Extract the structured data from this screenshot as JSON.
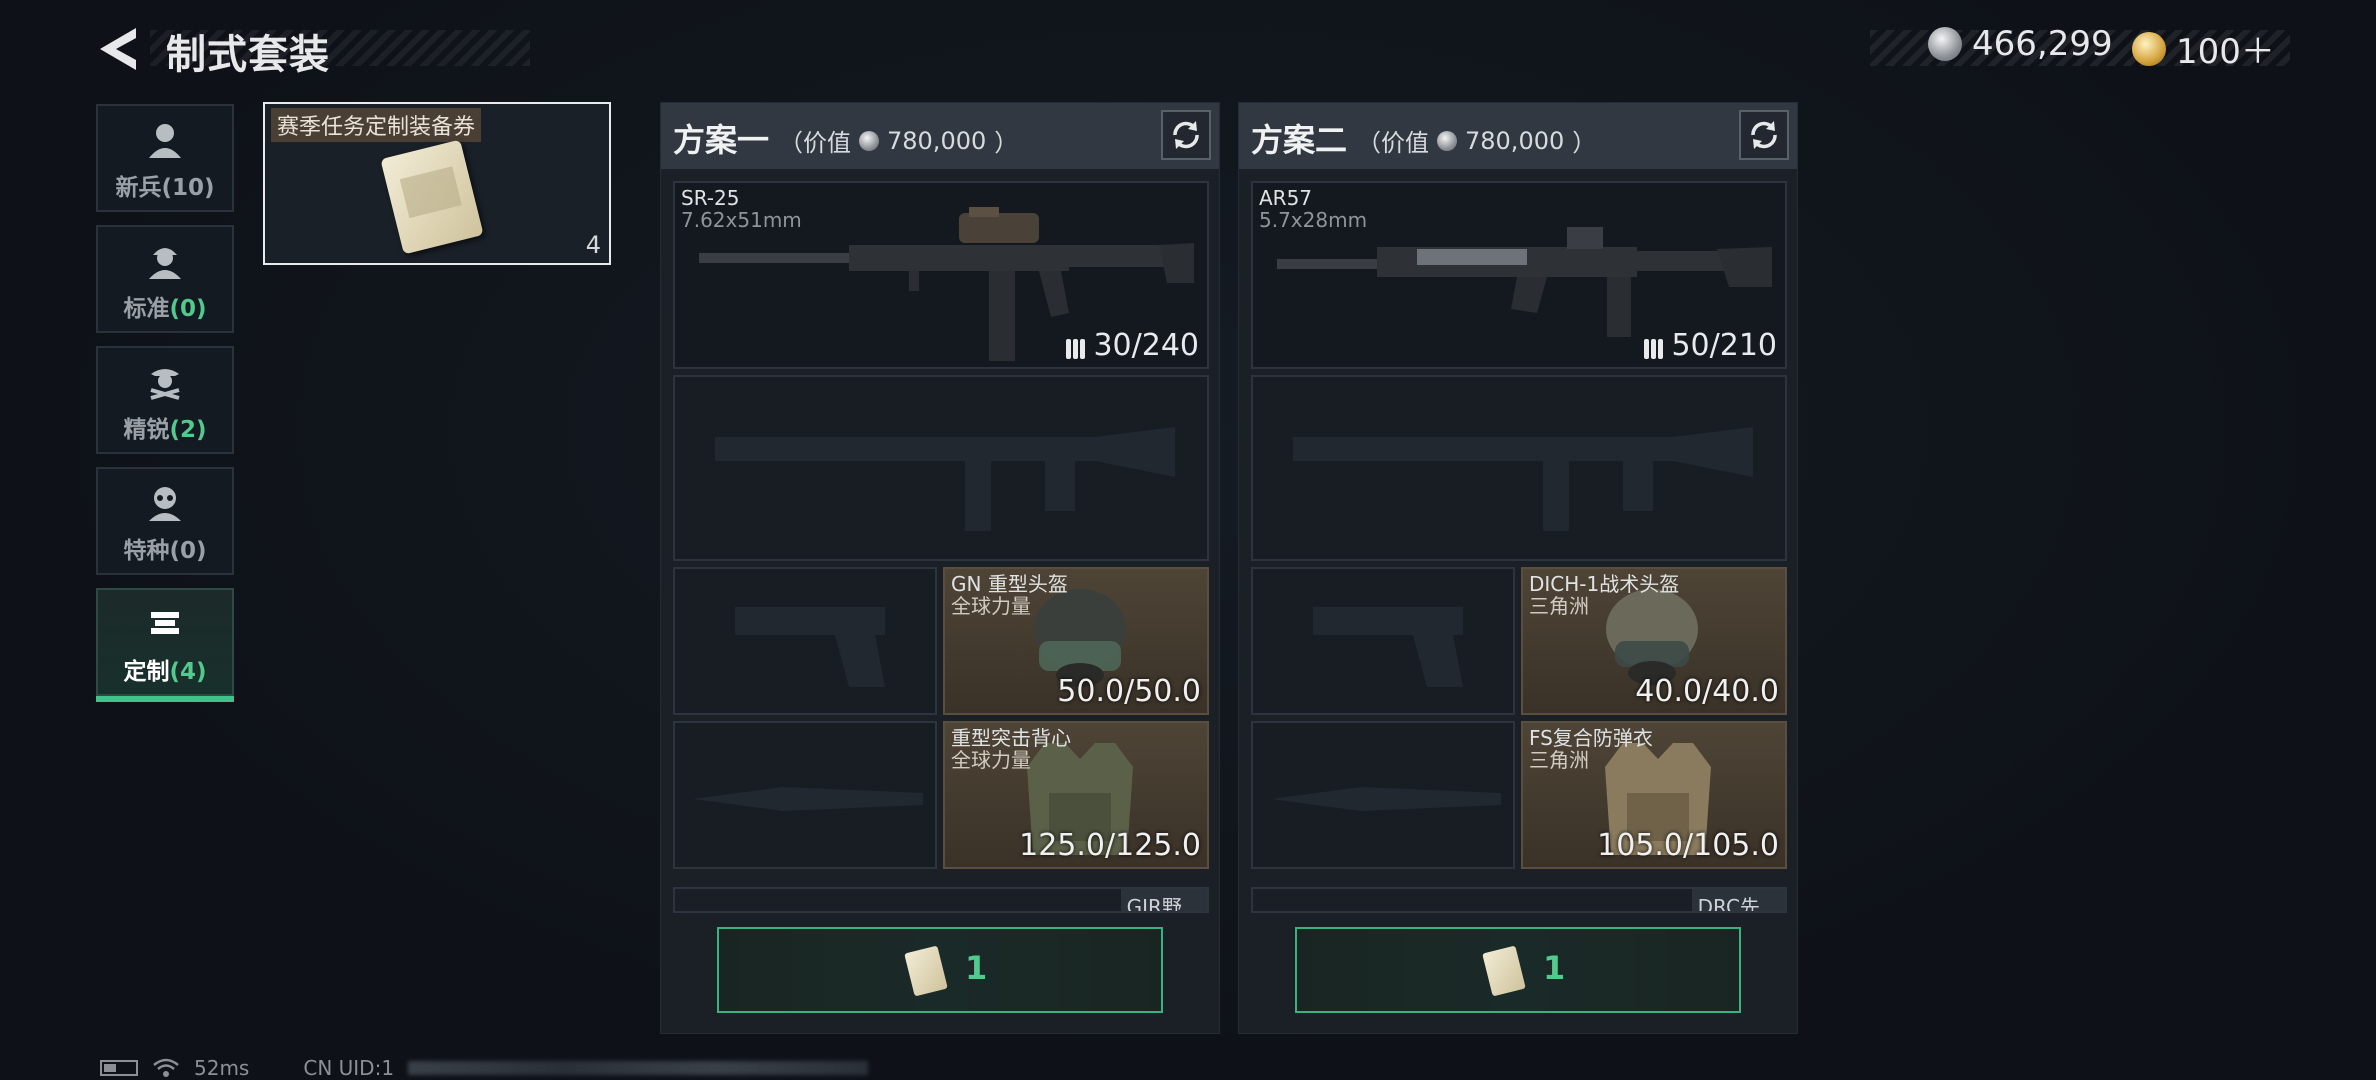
{
  "header": {
    "title": "制式套装"
  },
  "currency": [
    {
      "icon": "silver-coin-icon",
      "amount": "466,299"
    },
    {
      "icon": "gold-coin-icon",
      "amount": "100＋"
    }
  ],
  "sidebar": {
    "items": [
      {
        "label": "新兵",
        "count": "(10)",
        "icon": "soldier-icon",
        "count_color": "gray"
      },
      {
        "label": "标准",
        "count": "(0)",
        "icon": "standard-soldier-icon",
        "count_color": "green"
      },
      {
        "label": "精锐",
        "count": "(2)",
        "icon": "elite-soldier-icon",
        "count_color": "green"
      },
      {
        "label": "特种",
        "count": "(0)",
        "icon": "special-forces-icon",
        "count_color": "gray"
      },
      {
        "label": "定制",
        "count": "(4)",
        "icon": "custom-gun-icon",
        "count_color": "green",
        "active": true
      }
    ]
  },
  "voucher": {
    "tag": "赛季任务定制装备券",
    "count": "4"
  },
  "plans": [
    {
      "title": "方案一",
      "value_open": "（价值",
      "value": "780,000",
      "value_close": "）",
      "primary": {
        "name": "SR-25",
        "caliber": "7.62x51mm",
        "ammo": "30/240"
      },
      "helmet": {
        "name": "GN 重型头盔",
        "maker": "全球力量",
        "durability": "50.0/50.0"
      },
      "armor": {
        "name": "重型突击背心",
        "maker": "全球力量",
        "durability": "125.0/125.0"
      },
      "extra": "GIR野...",
      "claim_count": "1"
    },
    {
      "title": "方案二",
      "value_open": "（价值",
      "value": "780,000",
      "value_close": "）",
      "primary": {
        "name": "AR57",
        "caliber": "5.7x28mm",
        "ammo": "50/210"
      },
      "helmet": {
        "name": "DICH-1战术头盔",
        "maker": "三角洲",
        "durability": "40.0/40.0"
      },
      "armor": {
        "name": "FS复合防弹衣",
        "maker": "三角洲",
        "durability": "105.0/105.0"
      },
      "extra": "DRC先...",
      "claim_count": "1"
    }
  ],
  "footer": {
    "ping": "52ms",
    "uid_label": "CN UID:1"
  }
}
